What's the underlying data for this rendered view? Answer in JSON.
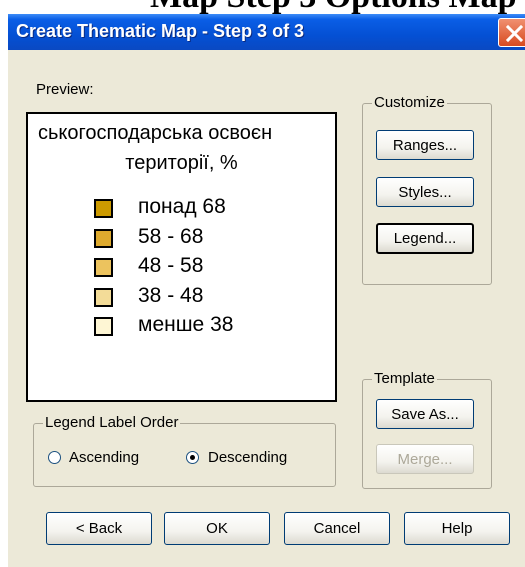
{
  "window": {
    "title": "Create Thematic Map - Step 3 of 3",
    "above_title_text": "Map Step 3 Options Map"
  },
  "preview": {
    "label": "Preview:",
    "legend_title_line1": "ськогосподарська освоєн",
    "legend_title_line2": "території, %",
    "items": [
      {
        "label": "понад 68",
        "color": "#cc9a00"
      },
      {
        "label": "58 - 68",
        "color": "#deaa2e"
      },
      {
        "label": "48 - 58",
        "color": "#ecc35e"
      },
      {
        "label": "38 - 48",
        "color": "#f3dc98"
      },
      {
        "label": "менше 38",
        "color": "#fef6d4"
      }
    ]
  },
  "customize": {
    "label": "Customize",
    "ranges": "Ranges...",
    "styles": "Styles...",
    "legend": "Legend..."
  },
  "template": {
    "label": "Template",
    "save_as": "Save As...",
    "merge": "Merge..."
  },
  "label_order": {
    "label": "Legend Label Order",
    "ascending": "Ascending",
    "descending": "Descending",
    "selected": "descending"
  },
  "footer": {
    "back": "< Back",
    "ok": "OK",
    "cancel": "Cancel",
    "help": "Help"
  }
}
